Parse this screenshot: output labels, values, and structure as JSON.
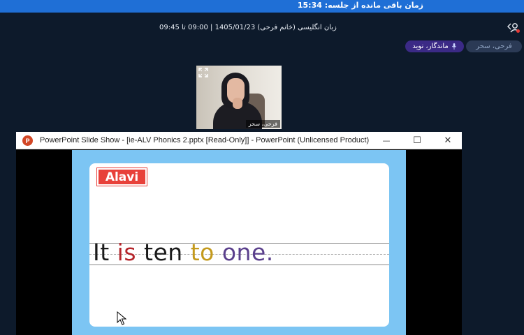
{
  "header": {
    "timer_text": "زمان باقی مانده از جلسه: 15:34"
  },
  "session": {
    "title": "زبان انگلیسی (خانم فرحی) 1405/01/23 | 09:00 تا 09:45"
  },
  "chips": {
    "mute_label": "ماندگار، نوید",
    "user_label": "فرحی، سحر"
  },
  "video": {
    "name_tag": "فرحی، سحر"
  },
  "powerpoint": {
    "logo_letter": "P",
    "window_title": "PowerPoint Slide Show - [ie-ALV Phonics 2.pptx [Read-Only]] - PowerPoint (Unlicensed Product)",
    "min_glyph": "—",
    "max_glyph": "☐",
    "close_glyph": "✕"
  },
  "slide": {
    "badge": "Alavi",
    "words": [
      "It",
      "is",
      "ten",
      "to",
      "one."
    ]
  },
  "colors": {
    "top_bar": "#1f6fd6",
    "background": "#0d1a2b",
    "mute_chip": "#3b2a86",
    "slide_bg": "#7cc5f3",
    "badge": "#e8413a",
    "word_red": "#b5252b",
    "word_yellow": "#c49a1c",
    "word_purple": "#5a3f8c"
  }
}
